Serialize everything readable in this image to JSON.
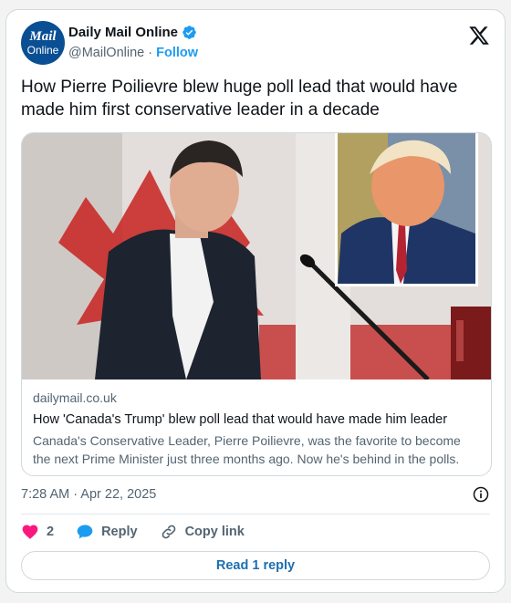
{
  "account": {
    "avatar_line1": "Mail",
    "avatar_line2": "Online",
    "display_name": "Daily Mail Online",
    "handle": "@MailOnline",
    "separator": "·",
    "follow_label": "Follow"
  },
  "tweet": {
    "text": "How Pierre Poilievre blew huge poll lead that would have made him first conservative leader in a decade"
  },
  "card": {
    "domain": "dailymail.co.uk",
    "title": "How 'Canada's Trump' blew poll lead that would have made him leader",
    "description": "Canada's Conservative Leader, Pierre Poilievre, was the favorite to become the next Prime Minister just three months ago. Now he's behind in the polls."
  },
  "meta": {
    "timestamp": "7:28 AM · Apr 22, 2025"
  },
  "actions": {
    "like_count": "2",
    "reply_label": "Reply",
    "copy_link_label": "Copy link"
  },
  "footer": {
    "read_reply_label": "Read 1 reply"
  },
  "colors": {
    "accent": "#1d9bf0",
    "heart": "#f91880",
    "verified": "#1d9bf0",
    "avatar_bg": "#0a4f93"
  },
  "icons": [
    "verified-badge-icon",
    "x-logo-icon",
    "info-icon",
    "heart-icon",
    "reply-bubble-icon",
    "link-icon"
  ]
}
